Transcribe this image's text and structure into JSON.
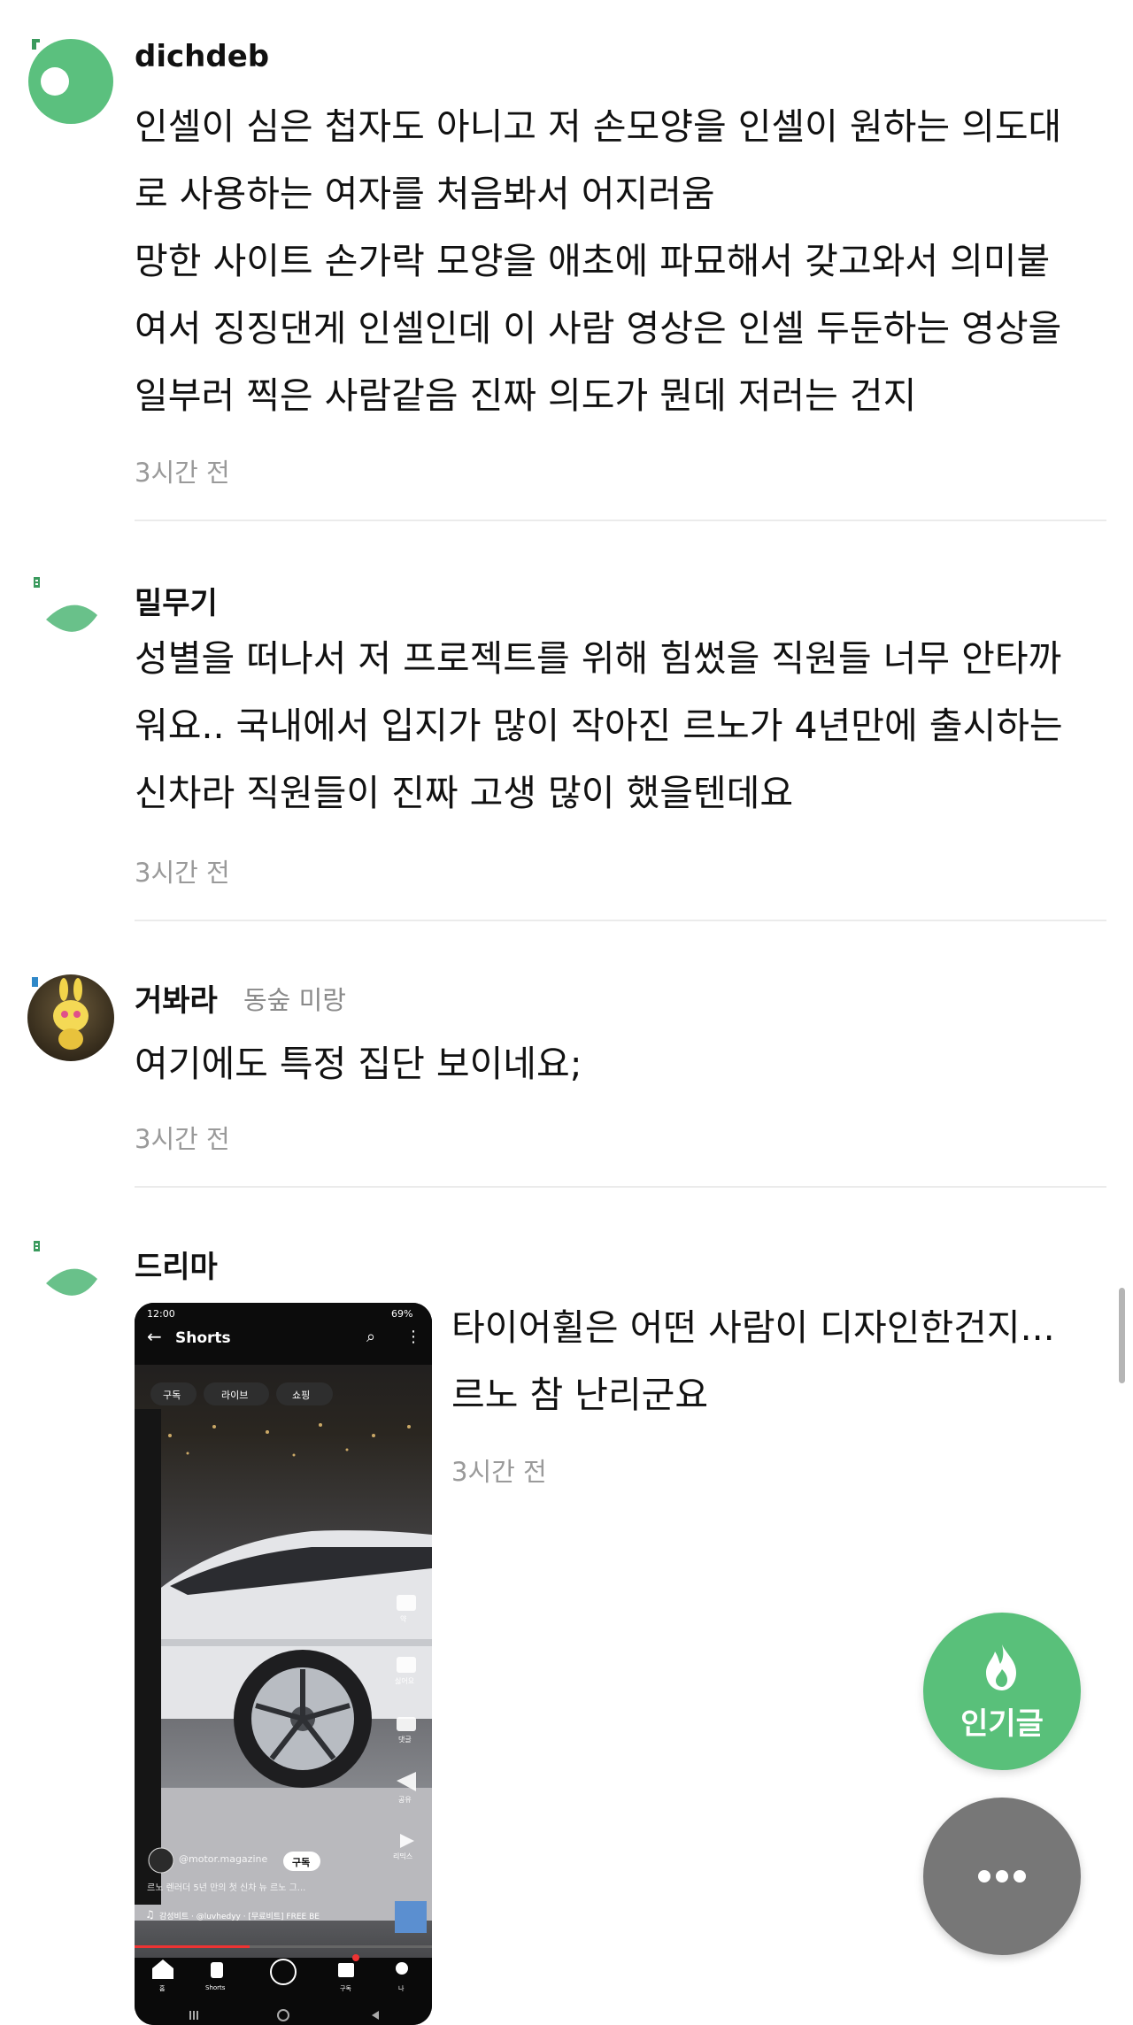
{
  "comments": [
    {
      "username": "dichdeb",
      "lines": [
        "인셀이 심은 첩자도 아니고 저 손모양을 인셀이 원하는 의도대",
        "로 사용하는 여자를 처음봐서 어지러움",
        "망한 사이트 손가락 모양을 애초에 파묘해서 갖고와서 의미붙",
        "여서 징징댄게 인셀인데 이 사람 영상은 인셀 두둔하는 영상을",
        "일부러 찍은 사람같음 진짜 의도가 뭔데 저러는 건지"
      ],
      "time": "3시간 전"
    },
    {
      "username": "밀무기",
      "lines": [
        "성별을 떠나서 저 프로젝트를 위해 힘썼을 직원들 너무 안타까",
        "워요.. 국내에서 입지가 많이 작아진 르노가 4년만에 출시하는",
        "신차라 직원들이 진짜 고생 많이 했을텐데요"
      ],
      "time": "3시간 전"
    },
    {
      "username": "거봐라",
      "tag": "동숲 미랑",
      "lines": [
        "여기에도 특정 집단 보이네요;"
      ],
      "time": "3시간 전"
    },
    {
      "username": "드리마",
      "lines": [
        "타이어휠은 어떤 사람이 디자인한건지...",
        "르노 참 난리군요"
      ],
      "time": "3시간 전"
    }
  ],
  "thumbnail": {
    "status_time": "12:00",
    "status_right": "69%",
    "header_title": "Shorts",
    "chips": [
      "구독",
      "라이브",
      "쇼핑"
    ],
    "channel_name": "@motor.magazine",
    "subscribe_label": "구독",
    "caption": "르노 렌러더 5년 만의 첫 신차 뉴 르노 그...",
    "music": "감성비트 · @luvhedyy · [무료비트] FREE BE",
    "side_labels": [
      "약",
      "싫어요",
      "댓글",
      "공유",
      "리믹스"
    ],
    "nav_labels": [
      "홈",
      "Shorts",
      "",
      "구독",
      "나"
    ]
  },
  "fab": {
    "popular_label": "인기글",
    "popular_icon": "flame-icon",
    "more_icon": "more-dots-icon"
  },
  "colors": {
    "accent_green": "#59c07a",
    "fab_gray": "#777777"
  }
}
